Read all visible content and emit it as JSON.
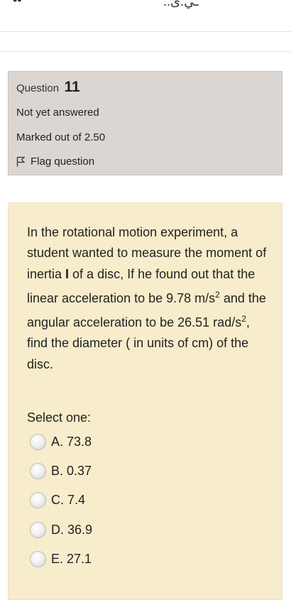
{
  "header": {
    "title_fragment": "..ـي.ى",
    "left_dots": "••"
  },
  "question": {
    "label": "Question",
    "number": "11",
    "state": "Not yet answered",
    "grade": "Marked out of 2.50",
    "flag_label": "Flag question",
    "text_before_bold": "In the rotational motion experiment, a student wanted to measure the moment of inertia ",
    "text_bold": "I",
    "text_after_bold": " of a disc, If he found out that the linear acceleration to be 9.78 m/s",
    "sup1": "2",
    "text_mid": " and the angular acceleration to be 26.51 rad/s",
    "sup2": "2",
    "text_end": ", find the diameter ( in units of cm) of the disc.",
    "prompt": "Select one:",
    "options": [
      {
        "letter": "A.",
        "value": "73.8"
      },
      {
        "letter": "B.",
        "value": "0.37"
      },
      {
        "letter": "C.",
        "value": "7.4"
      },
      {
        "letter": "D.",
        "value": "36.9"
      },
      {
        "letter": "E.",
        "value": "27.1"
      }
    ]
  },
  "colors": {
    "info_bg": "#dcd6d3",
    "content_bg": "#f7eccb"
  }
}
